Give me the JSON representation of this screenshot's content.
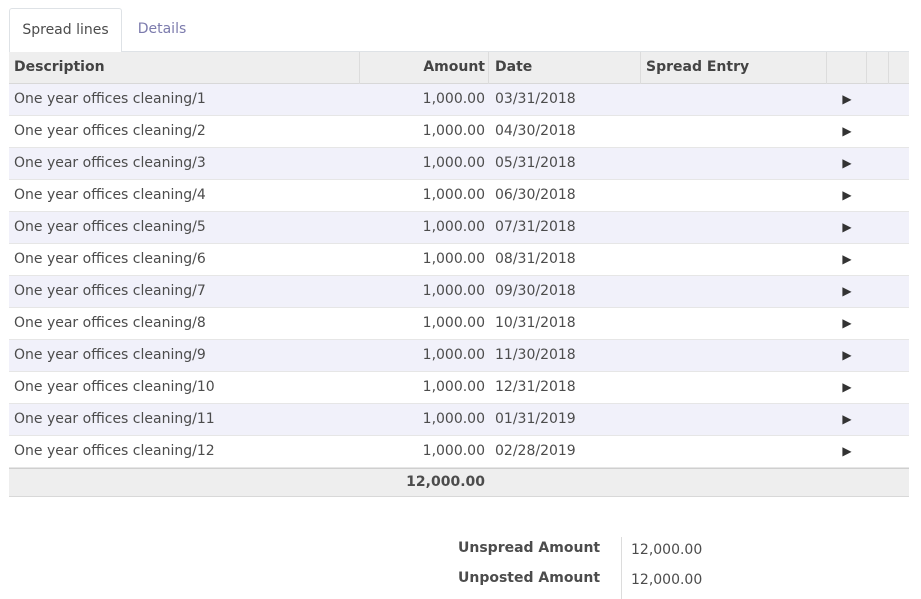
{
  "tabs": [
    {
      "label": "Spread lines",
      "active": true
    },
    {
      "label": "Details",
      "active": false
    }
  ],
  "table": {
    "columns": [
      "Description",
      "Amount",
      "Date",
      "Spread Entry"
    ],
    "rows": [
      {
        "description": "One year offices cleaning/1",
        "amount": "1,000.00",
        "date": "03/31/2018",
        "entry": ""
      },
      {
        "description": "One year offices cleaning/2",
        "amount": "1,000.00",
        "date": "04/30/2018",
        "entry": ""
      },
      {
        "description": "One year offices cleaning/3",
        "amount": "1,000.00",
        "date": "05/31/2018",
        "entry": ""
      },
      {
        "description": "One year offices cleaning/4",
        "amount": "1,000.00",
        "date": "06/30/2018",
        "entry": ""
      },
      {
        "description": "One year offices cleaning/5",
        "amount": "1,000.00",
        "date": "07/31/2018",
        "entry": ""
      },
      {
        "description": "One year offices cleaning/6",
        "amount": "1,000.00",
        "date": "08/31/2018",
        "entry": ""
      },
      {
        "description": "One year offices cleaning/7",
        "amount": "1,000.00",
        "date": "09/30/2018",
        "entry": ""
      },
      {
        "description": "One year offices cleaning/8",
        "amount": "1,000.00",
        "date": "10/31/2018",
        "entry": ""
      },
      {
        "description": "One year offices cleaning/9",
        "amount": "1,000.00",
        "date": "11/30/2018",
        "entry": ""
      },
      {
        "description": "One year offices cleaning/10",
        "amount": "1,000.00",
        "date": "12/31/2018",
        "entry": ""
      },
      {
        "description": "One year offices cleaning/11",
        "amount": "1,000.00",
        "date": "01/31/2019",
        "entry": ""
      },
      {
        "description": "One year offices cleaning/12",
        "amount": "1,000.00",
        "date": "02/28/2019",
        "entry": ""
      }
    ],
    "footer_total": "12,000.00",
    "action_icon": "play-icon",
    "action_glyph": "▶"
  },
  "totals": {
    "unspread_label": "Unspread Amount",
    "unspread_value": "12,000.00",
    "unposted_label": "Unposted Amount",
    "unposted_value": "12,000.00"
  },
  "colors": {
    "link": "#7c7bad",
    "row_odd": "#f1f1fa",
    "header_bg": "#eeeeee"
  }
}
